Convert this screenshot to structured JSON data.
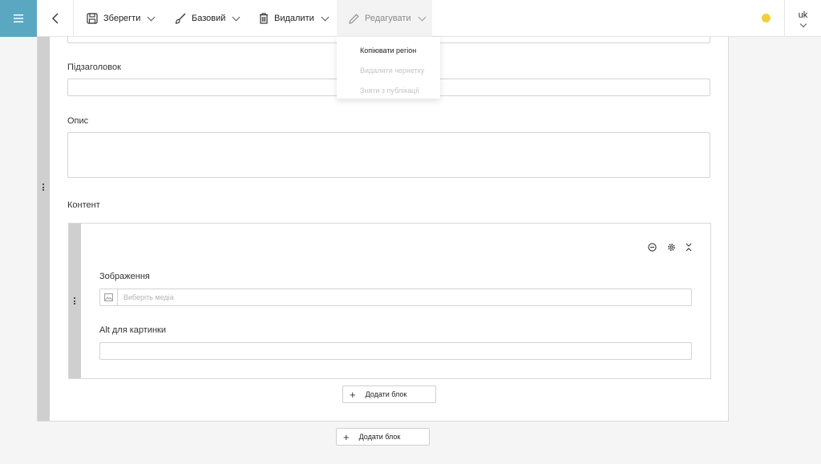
{
  "toolbar": {
    "save_label": "Зберегти",
    "base_label": "Базовий",
    "delete_label": "Видалити",
    "edit_label": "Редагувати",
    "language": "uk",
    "status_color": "#f2cf3a",
    "accent_color": "#5aa7c2"
  },
  "dropdown": {
    "items": [
      {
        "label": "Копіювати регіон",
        "enabled": true
      },
      {
        "label": "Видалити чернетку",
        "enabled": false
      },
      {
        "label": "Зняти з публікації",
        "enabled": false
      }
    ]
  },
  "form": {
    "subtitle_label": "Підзаголовок",
    "subtitle_value": "",
    "description_label": "Опис",
    "description_value": "",
    "content_label": "Контент"
  },
  "block": {
    "image_label": "Зображення",
    "image_placeholder": "Виберіть медіа",
    "alt_label": "Alt для картинки",
    "alt_value": "",
    "add_block_label": "Додати блок"
  },
  "region": {
    "add_block_label": "Додати блок"
  }
}
